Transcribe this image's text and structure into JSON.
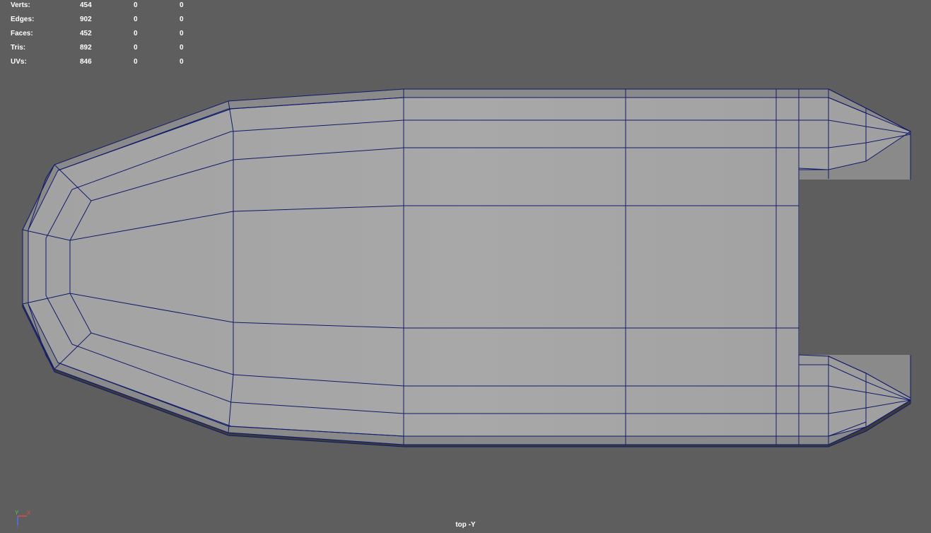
{
  "hud": {
    "stats": [
      {
        "label": "Verts:",
        "total": "454",
        "selected": "0",
        "third": "0"
      },
      {
        "label": "Edges:",
        "total": "902",
        "selected": "0",
        "third": "0"
      },
      {
        "label": "Faces:",
        "total": "452",
        "selected": "0",
        "third": "0"
      },
      {
        "label": "Tris:",
        "total": "892",
        "selected": "0",
        "third": "0"
      },
      {
        "label": "UVs:",
        "total": "846",
        "selected": "0",
        "third": "0"
      }
    ]
  },
  "viewport": {
    "camera_label": "top -Y",
    "background_color": "#5e5e5e",
    "mesh_face_color": "#a5a5a5",
    "wireframe_color": "#101b6b",
    "shadow_color": "#3a3a3a"
  },
  "axis_gizmo": {
    "y_label": "Y",
    "x_label": "X",
    "y_color": "#4ecf4e",
    "x_color": "#e04b4b",
    "z_color": "#4d73e8"
  }
}
